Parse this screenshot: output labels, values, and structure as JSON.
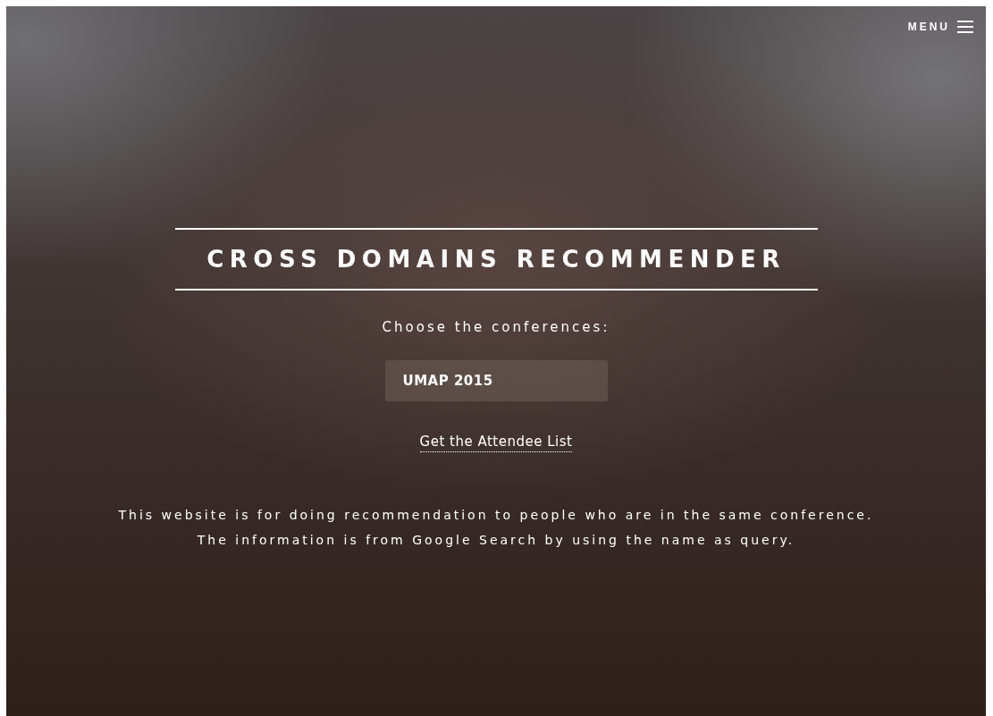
{
  "menu": {
    "label": "MENU"
  },
  "title": "CROSS DOMAINS RECOMMENDER",
  "prompt": "Choose the conferences:",
  "conference_field": {
    "value": "UMAP 2015"
  },
  "link": "Get the Attendee List",
  "description": [
    "This website is for doing recommendation to people who are in the same conference.",
    "The information is from Google Search by using the name as query."
  ]
}
